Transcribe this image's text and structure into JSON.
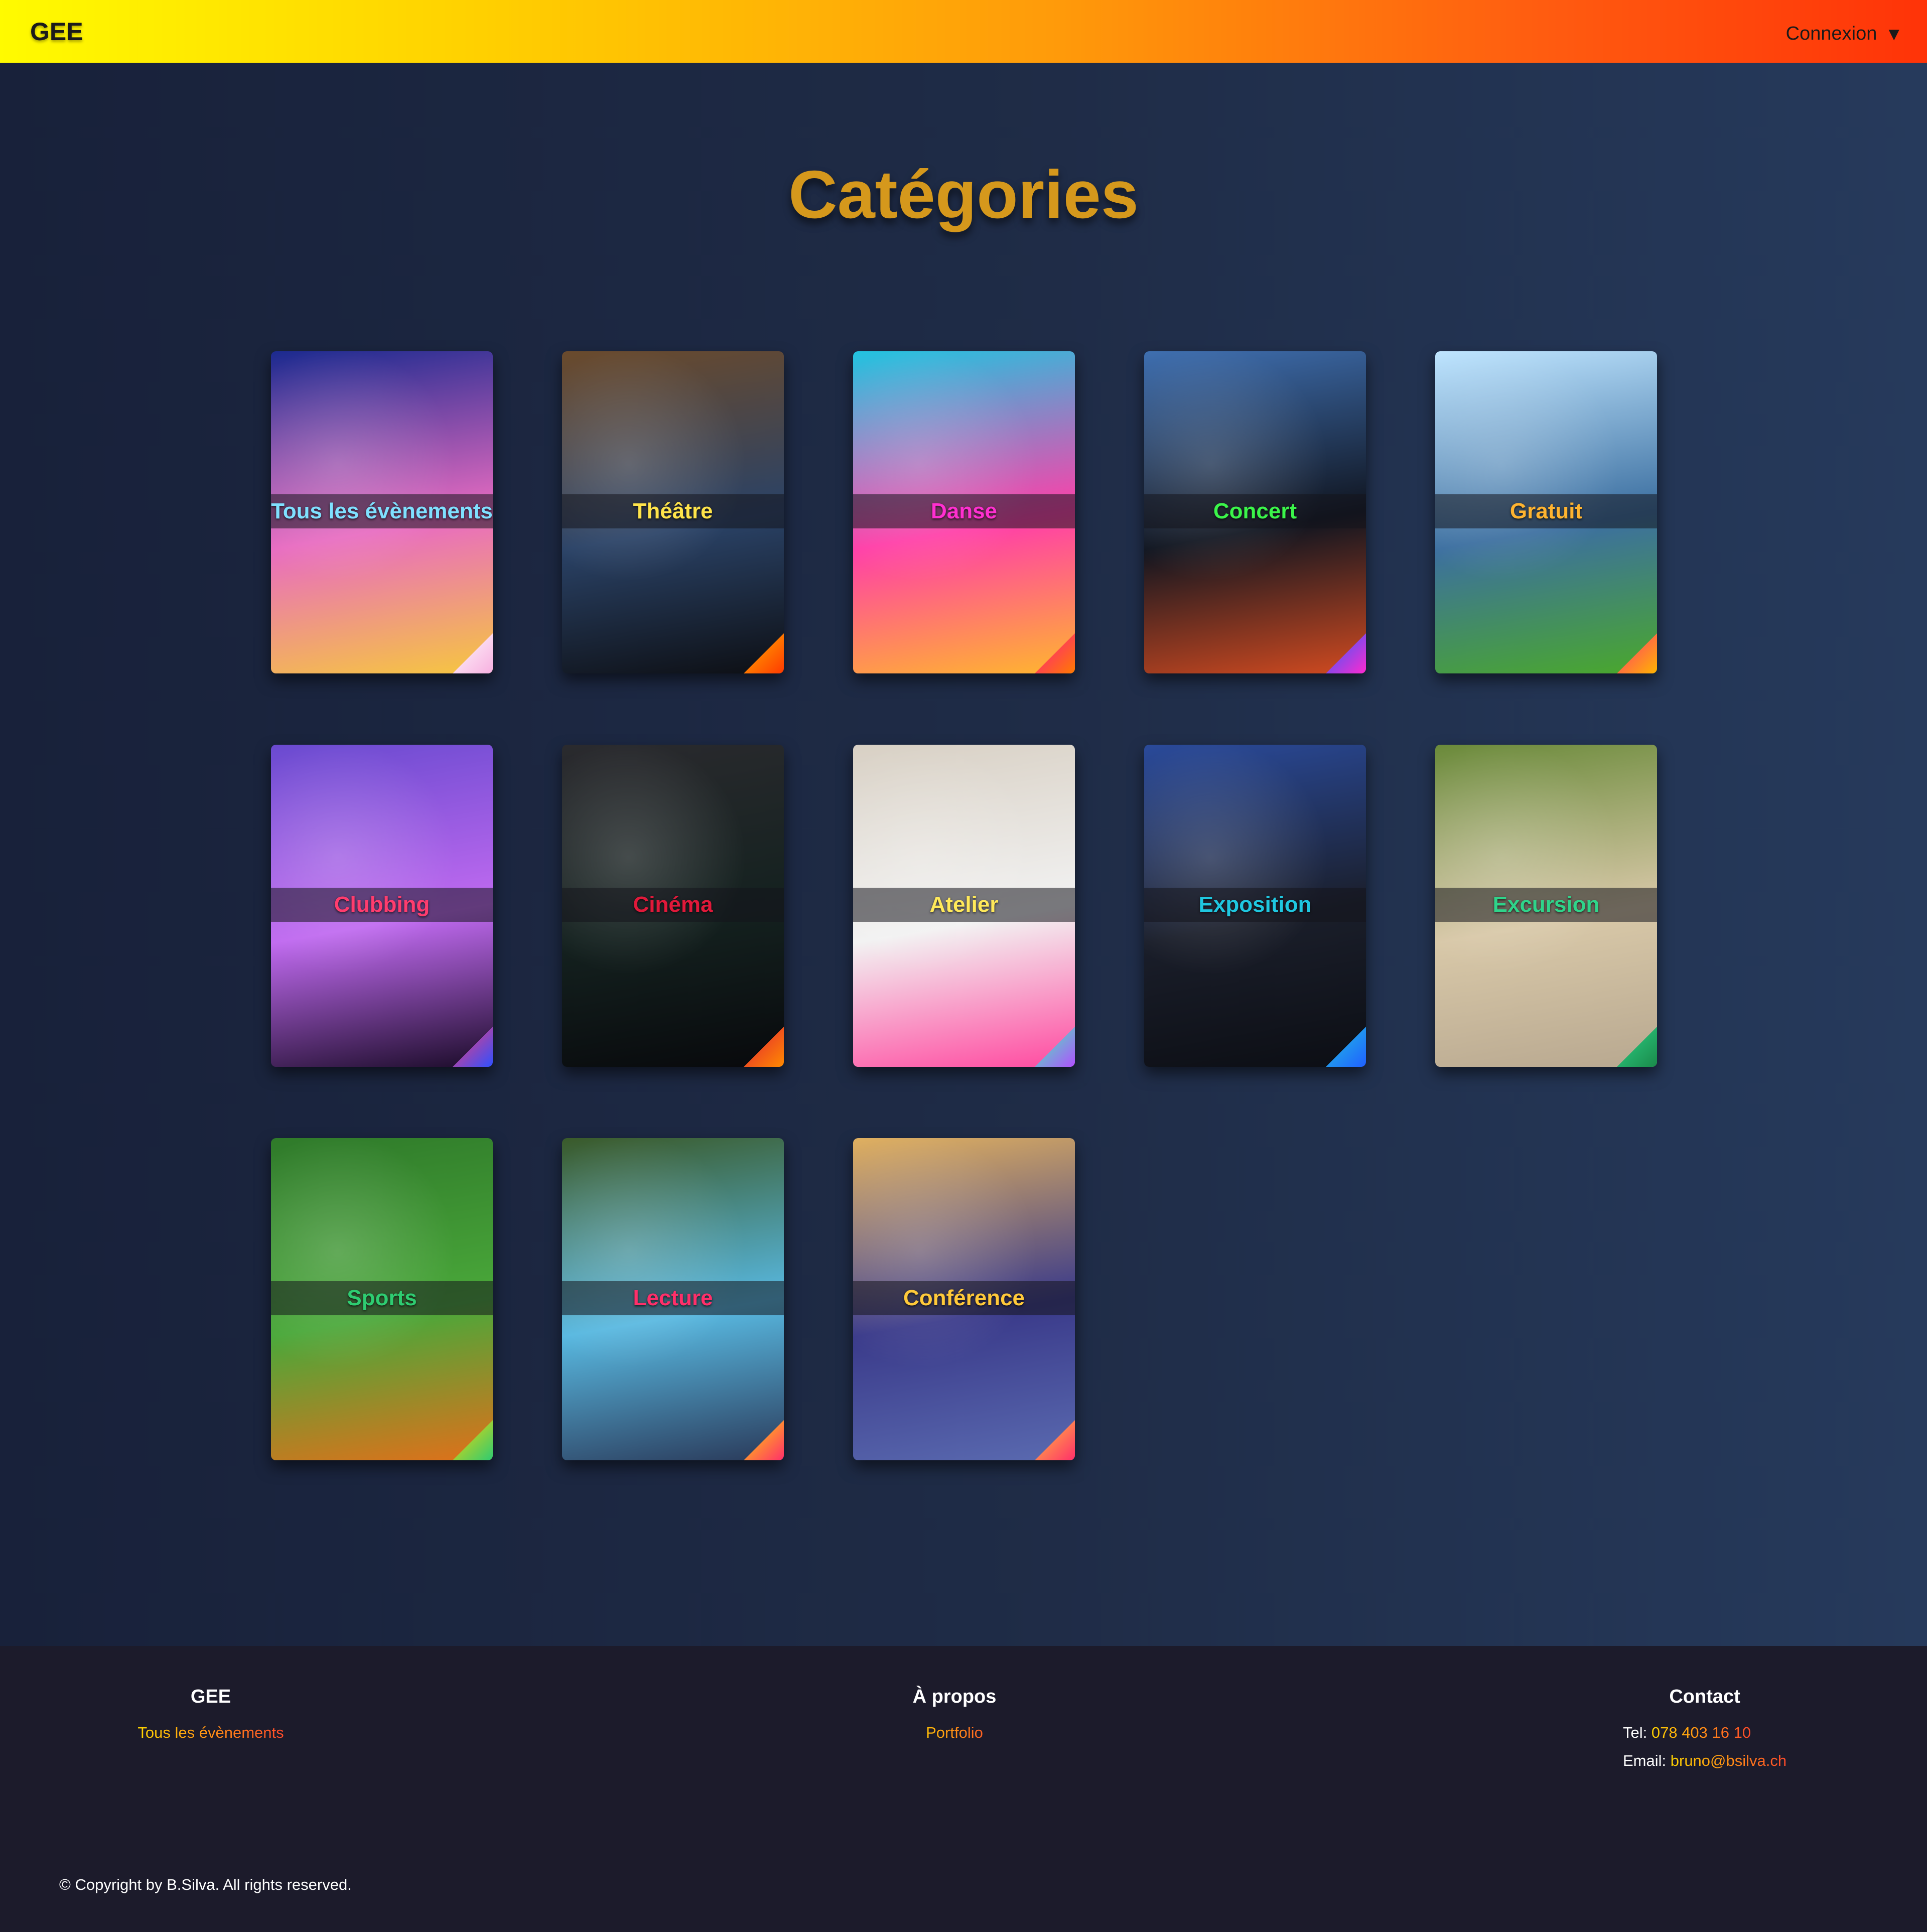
{
  "header": {
    "logo": "GEE",
    "login_label": "Connexion",
    "login_caret": "▼"
  },
  "page": {
    "title": "Catégories"
  },
  "categories": [
    {
      "label": "Tous les évènements",
      "color": "#7fe0ff",
      "icon": "geneva-jet-fountain-image",
      "bg": [
        "#1b2a8f",
        "#e86cc1",
        "#f6c640"
      ],
      "corner": [
        "#ffffff",
        "#f7b0e0"
      ]
    },
    {
      "label": "Théâtre",
      "color": "#ffe44a",
      "icon": "theatre-stage-image",
      "bg": [
        "#6a4a2c",
        "#2a4266",
        "#0d0f14"
      ],
      "corner": [
        "#ffb400",
        "#ff3a00"
      ]
    },
    {
      "label": "Danse",
      "color": "#ff2fd0",
      "icon": "dancer-leap-image",
      "bg": [
        "#21c4e0",
        "#ff3fa8",
        "#ffb52f"
      ],
      "corner": [
        "#ff1493",
        "#ff7a00"
      ]
    },
    {
      "label": "Concert",
      "color": "#3bf54a",
      "icon": "concert-stage-crowd-image",
      "bg": [
        "#3f6fb0",
        "#101520",
        "#d04a20"
      ],
      "corner": [
        "#2060ff",
        "#ff2ad0"
      ]
    },
    {
      "label": "Gratuit",
      "color": "#ffb430",
      "icon": "open-air-festival-image",
      "bg": [
        "#bfe5ff",
        "#3c6fa0",
        "#4aa82c"
      ],
      "corner": [
        "#ff2f7a",
        "#ffb400"
      ]
    },
    {
      "label": "Clubbing",
      "color": "#ff3c6e",
      "icon": "nightclub-dj-image",
      "bg": [
        "#6a4ad0",
        "#c06af0",
        "#1c0c2a"
      ],
      "corner": [
        "#ff3c6e",
        "#3050ff"
      ]
    },
    {
      "label": "Cinéma",
      "color": "#e0193a",
      "icon": "cinema-screen-image",
      "bg": [
        "#2a2a2e",
        "#14211f",
        "#08090c"
      ],
      "corner": [
        "#e0193a",
        "#ff8a00"
      ]
    },
    {
      "label": "Atelier",
      "color": "#ffe95a",
      "icon": "creative-workshop-image",
      "bg": [
        "#d8d0c4",
        "#f2f2f2",
        "#ff4aa0"
      ],
      "corner": [
        "#40ffb0",
        "#b050ff"
      ]
    },
    {
      "label": "Exposition",
      "color": "#1fc7e0",
      "icon": "immersive-exhibition-image",
      "bg": [
        "#2a4a9a",
        "#1a1e2a",
        "#0c0e14"
      ],
      "corner": [
        "#1fc7e0",
        "#2060ff"
      ]
    },
    {
      "label": "Excursion",
      "color": "#2fd48a",
      "icon": "hikers-walking-image",
      "bg": [
        "#6a8a3a",
        "#d8c8a8",
        "#b8a890"
      ],
      "corner": [
        "#2fd48a",
        "#1a8a4a"
      ]
    },
    {
      "label": "Sports",
      "color": "#2ecc71",
      "icon": "sports-equipment-image",
      "bg": [
        "#2f7a2a",
        "#4aa83a",
        "#e0701a"
      ],
      "corner": [
        "#ffd400",
        "#2ecc71"
      ]
    },
    {
      "label": "Lecture",
      "color": "#ff2f6a",
      "icon": "children-reading-image",
      "bg": [
        "#3a5a2a",
        "#58b8e0",
        "#2a3a5a"
      ],
      "corner": [
        "#ffe000",
        "#ff2f6a"
      ]
    },
    {
      "label": "Conférence",
      "color": "#ffc93a",
      "icon": "conference-hall-image",
      "bg": [
        "#e0b060",
        "#3a3a8a",
        "#5a6ab0"
      ],
      "corner": [
        "#ffc93a",
        "#ff2f6a"
      ]
    }
  ],
  "footer": {
    "col1": {
      "title": "GEE",
      "link": "Tous les évènements"
    },
    "col2": {
      "title": "À propos",
      "link": "Portfolio"
    },
    "col3": {
      "title": "Contact",
      "tel_label": "Tel: ",
      "tel": "078 403 16 10",
      "email_label": "Email: ",
      "email": "bruno@bsilva.ch"
    },
    "copyright": "© Copyright by B.Silva. All rights reserved."
  }
}
